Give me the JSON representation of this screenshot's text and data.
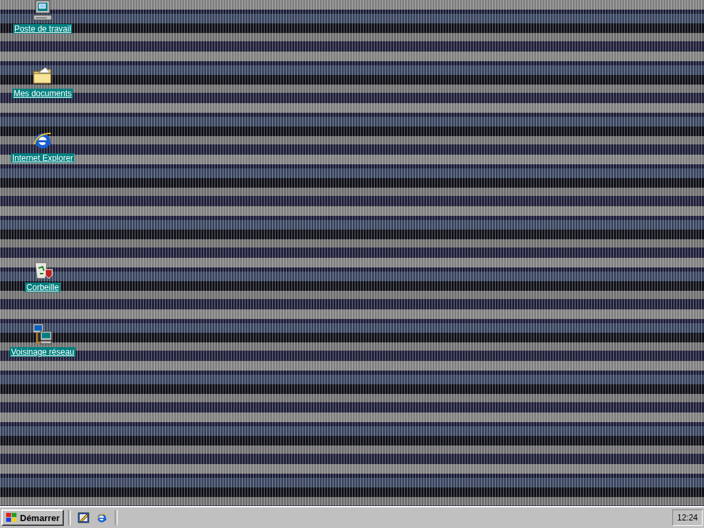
{
  "desktop_icons": [
    {
      "kind": "computer",
      "label": "Poste de travail"
    },
    {
      "kind": "documents",
      "label": "Mes documents"
    },
    {
      "kind": "browser",
      "label": "Internet Explorer"
    },
    {
      "kind": "recycle",
      "label": "Corbeille"
    },
    {
      "kind": "network",
      "label": "Voisinage réseau"
    }
  ],
  "taskbar": {
    "start_button": "Démarrer",
    "quick_launch": [
      {
        "kind": "desktop"
      },
      {
        "kind": "browser"
      }
    ],
    "clock": "12:24"
  }
}
